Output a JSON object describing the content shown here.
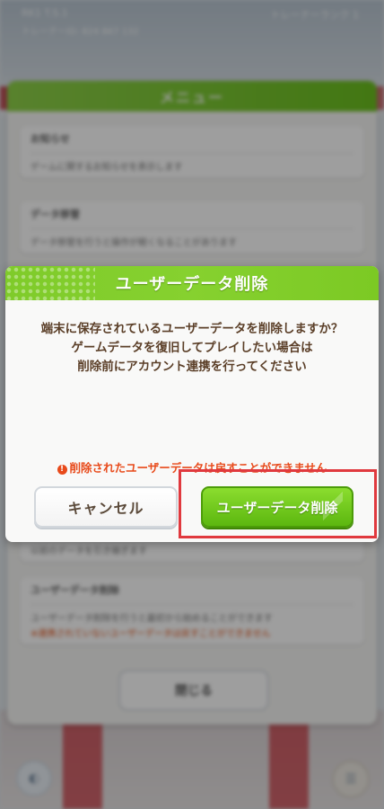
{
  "status": {
    "line1": "RK1 T.S.1",
    "line2": "トレーナーID: 824 867 132",
    "right": "トレーナーランク 1"
  },
  "menu": {
    "title": "メニュー",
    "items": [
      {
        "title": "お知らせ",
        "desc": "ゲームに関するお知らせを表示します"
      },
      {
        "title": "データ移管",
        "desc": "データ移管を行うと操作が軽くなることがあります"
      },
      {
        "title": "",
        "desc": "以前のデータを引き継ぎます"
      },
      {
        "title": "ユーザーデータ削除",
        "desc": "ユーザーデータ削除を行うと最初から始めることができます",
        "warn": "※連携されていないユーザーデータは戻すことができません"
      }
    ],
    "close_label": "閉じる"
  },
  "dialog": {
    "title": "ユーザーデータ削除",
    "message_lines": [
      "端末に保存されているユーザーデータを削除しますか？",
      "ゲームデータを復旧してプレイしたい場合は",
      "削除前にアカウント連携を行ってください"
    ],
    "warning": "削除されたユーザーデータは戻すことができません",
    "cancel_label": "キャンセル",
    "delete_label": "ユーザーデータ削除"
  },
  "colors": {
    "accent_green": "#6cc11f",
    "warning_red": "#e84a1a",
    "highlight_red": "#e0393e"
  },
  "icons": {
    "warning": "exclamation-circle-icon",
    "left_corner": "circle-button-icon",
    "right_corner": "list-icon"
  }
}
